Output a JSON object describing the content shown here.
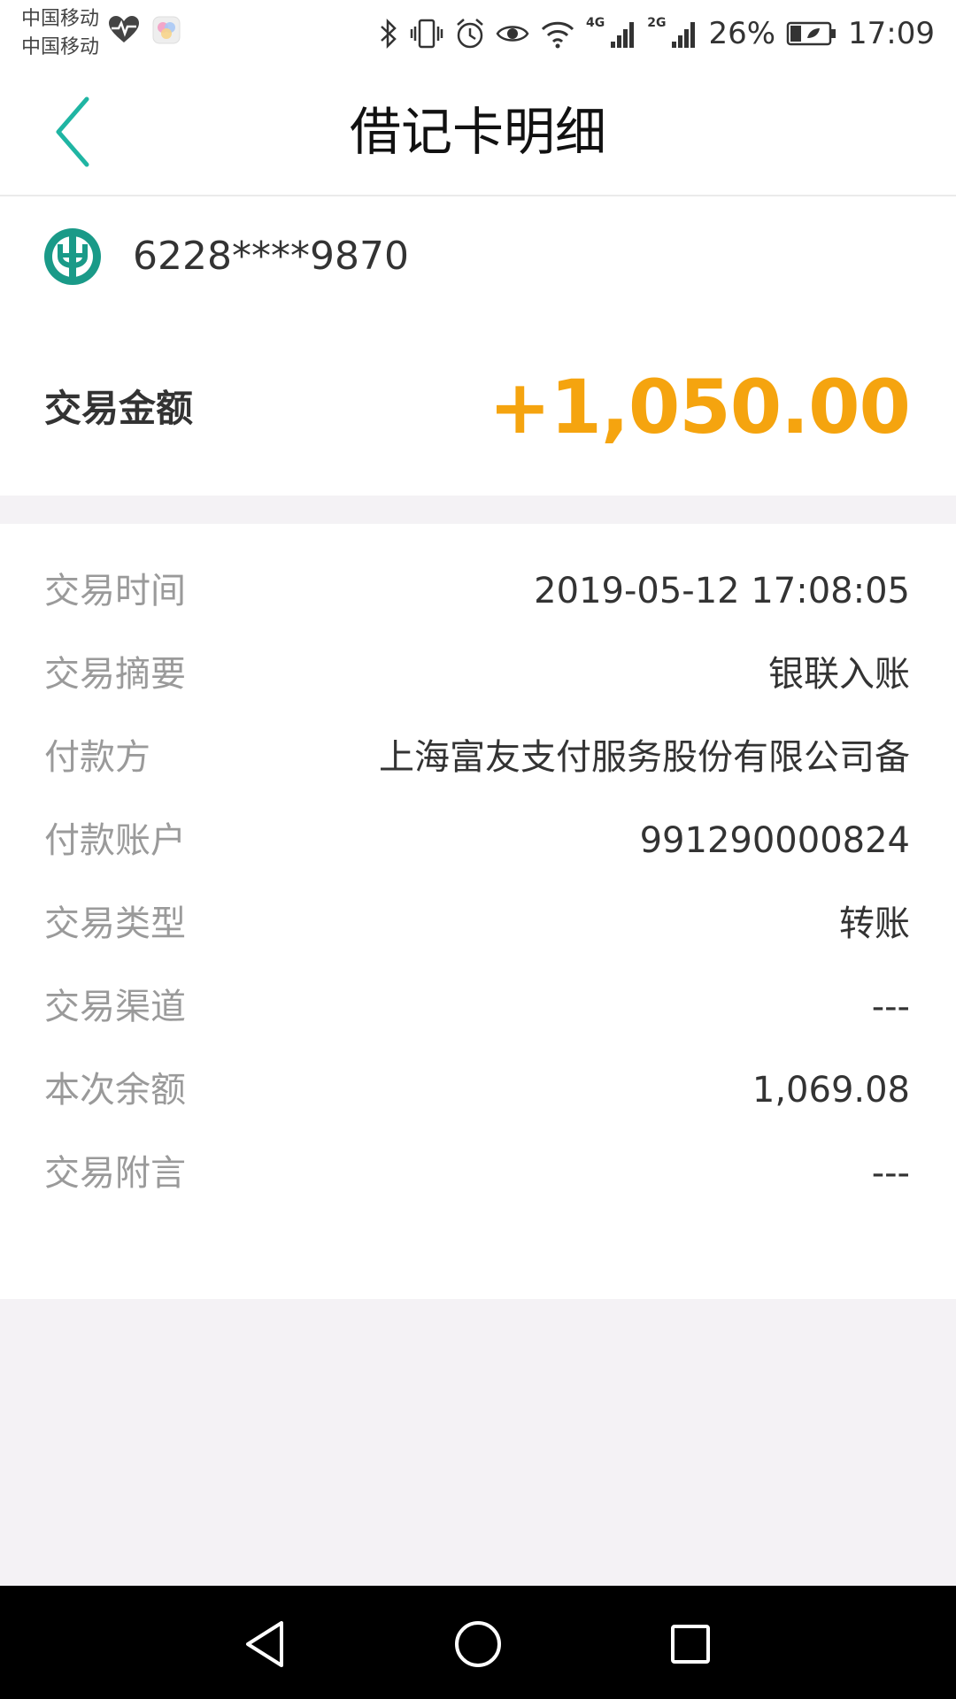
{
  "status_bar": {
    "carrier_1": "中国移动",
    "carrier_2": "中国移动",
    "net_4g": "4G",
    "net_2g": "2G",
    "battery": "26%",
    "time": "17:09"
  },
  "header": {
    "title": "借记卡明细",
    "back_icon": "chevron-left-icon"
  },
  "card": {
    "bank_logo_icon": "bank-logo-icon",
    "number": "6228****9870",
    "amount_label": "交易金额",
    "amount_value": "+1,050.00"
  },
  "details": [
    {
      "label": "交易时间",
      "value": "2019-05-12 17:08:05"
    },
    {
      "label": "交易摘要",
      "value": "银联入账"
    },
    {
      "label": "付款方",
      "value": "上海富友支付服务股份有限公司备"
    },
    {
      "label": "付款账户",
      "value": "991290000824"
    },
    {
      "label": "交易类型",
      "value": "转账"
    },
    {
      "label": "交易渠道",
      "value": "---"
    },
    {
      "label": "本次余额",
      "value": "1,069.08"
    },
    {
      "label": "交易附言",
      "value": "---"
    }
  ],
  "colors": {
    "accent": "#1fb5a3",
    "amount": "#f5a40f",
    "background": "#f4f2f5"
  }
}
